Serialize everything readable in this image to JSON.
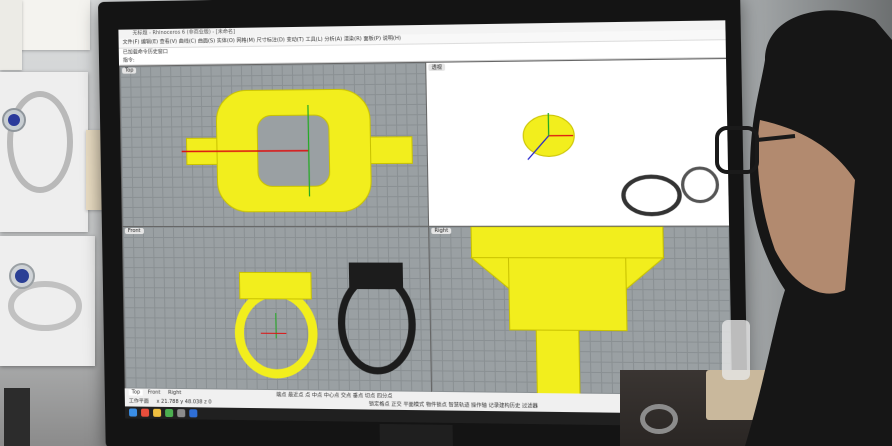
{
  "app": {
    "window_title": "无标题 - Rhinoceros 6 (非商业版) - [未命名]",
    "menu_items": [
      "文件(F)",
      "编辑(E)",
      "查看(V)",
      "曲线(C)",
      "曲面(S)",
      "实体(O)",
      "网格(M)",
      "尺寸标注(D)",
      "变动(T)",
      "工具(L)",
      "分析(A)",
      "渲染(R)",
      "面板(P)",
      "说明(H)"
    ],
    "command_line": [
      "已加载命令历史窗口",
      "指令:"
    ]
  },
  "viewports": [
    {
      "label": "Top"
    },
    {
      "label": "透视"
    },
    {
      "label": "Front"
    },
    {
      "label": "Right"
    }
  ],
  "tabs": [
    "Top",
    "Front",
    "Right"
  ],
  "status": {
    "workplane": "工作平面",
    "coords": "x 21.788  y 48.038  z 0",
    "osnap_items": [
      "端点",
      "最近点",
      "点",
      "中点",
      "中心点",
      "交点",
      "垂点",
      "切点",
      "四分点"
    ],
    "mode_items": [
      "锁定格点",
      "正交",
      "平面模式",
      "物件锁点",
      "智慧轨迹",
      "操作轴",
      "记录建构历史",
      "过滤器"
    ]
  },
  "colors": {
    "model_yellow": "#f2ee1d",
    "viewport_grey": "#9aa0a3",
    "monitor_bezel": "#141414"
  }
}
